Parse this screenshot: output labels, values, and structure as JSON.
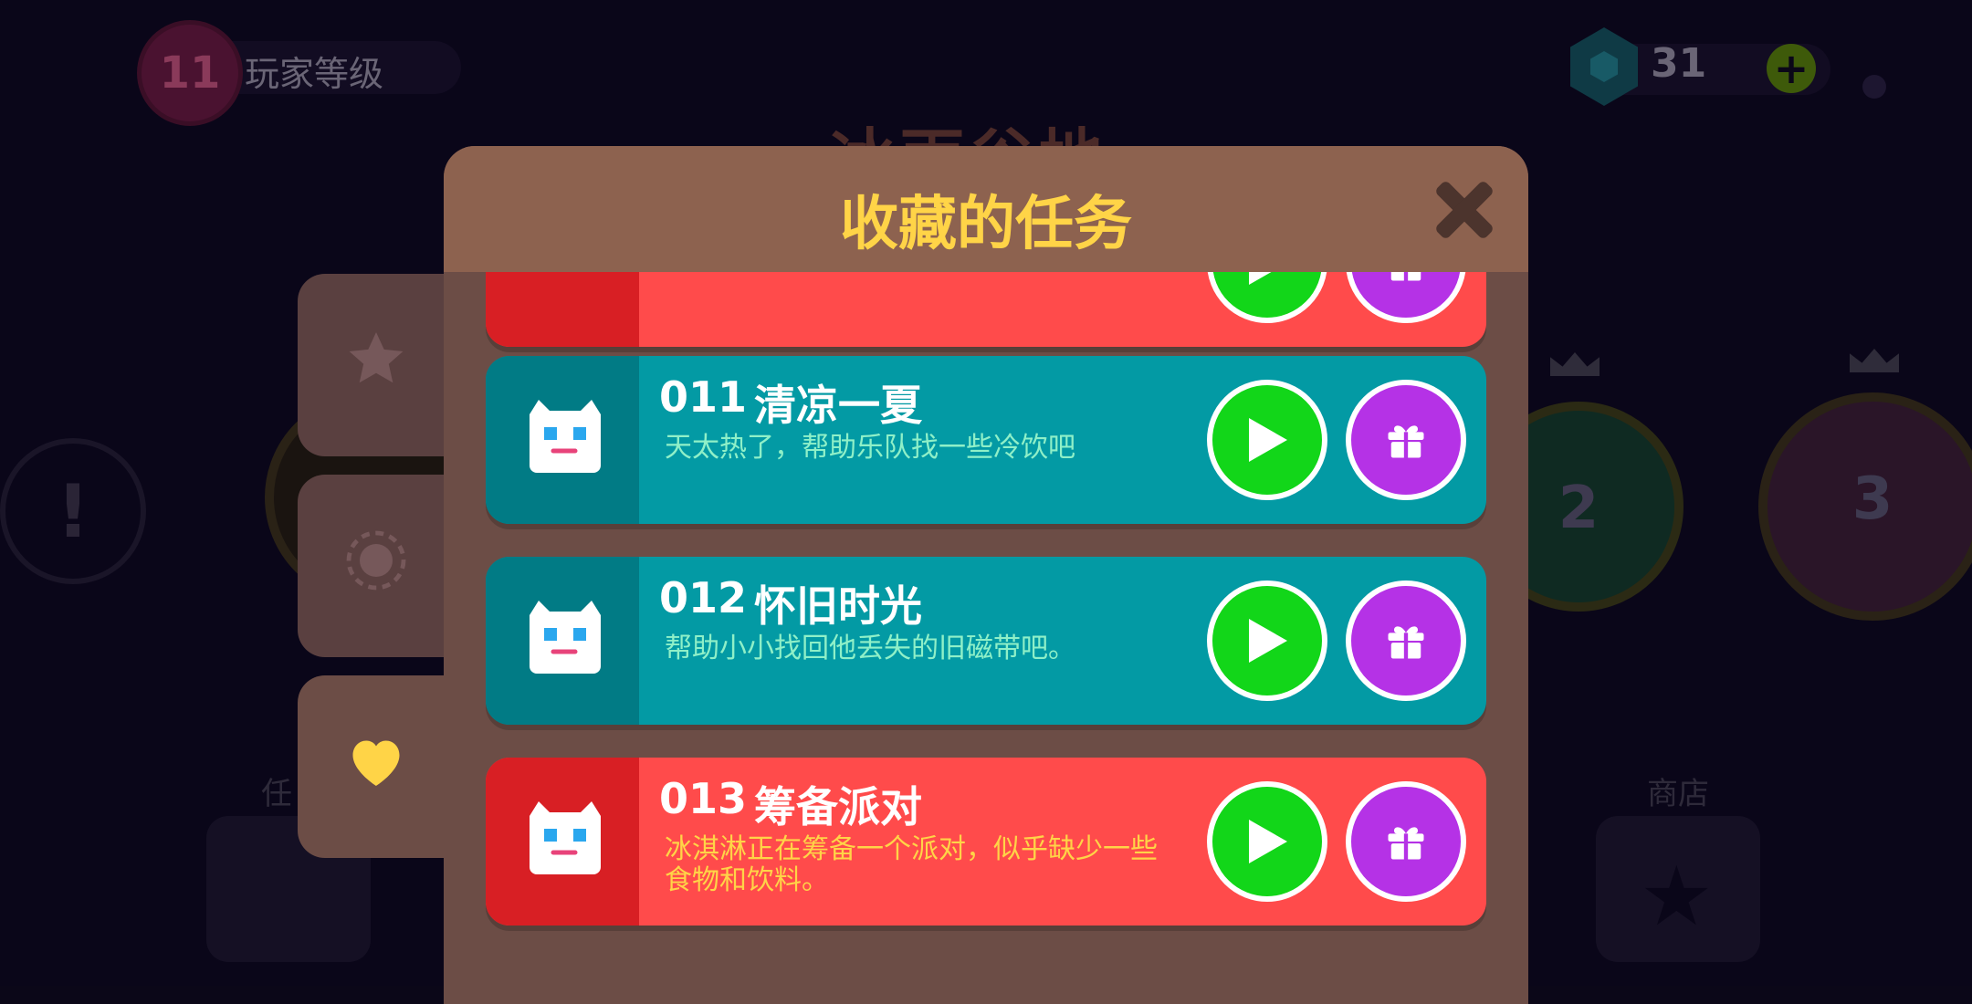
{
  "background": {
    "player_level": "11",
    "player_level_label": "玩家等级",
    "gem_count": "31",
    "area_title": "冰雨谷地",
    "map_node_2": "2",
    "map_node_3": "3",
    "label_left": "任",
    "label_right": "商店"
  },
  "modal": {
    "title": "收藏的任务",
    "tabs": [
      {
        "name": "star-icon",
        "active": false
      },
      {
        "name": "sun-icon",
        "active": false
      },
      {
        "name": "heart-icon",
        "active": true
      }
    ],
    "quests": [
      {
        "code": "",
        "name": "",
        "desc": "",
        "color": "red"
      },
      {
        "code": "011",
        "name": "清凉一夏",
        "desc": "天太热了，帮助乐队找一些冷饮吧",
        "color": "teal"
      },
      {
        "code": "012",
        "name": "怀旧时光",
        "desc": "帮助小小找回他丢失的旧磁带吧。",
        "color": "teal"
      },
      {
        "code": "013",
        "name": "筹备派对",
        "desc": "冰淇淋正在筹备一个派对，似乎缺少一些食物和饮料。",
        "color": "red"
      }
    ]
  },
  "colors": {
    "title_yellow": "#ffd447",
    "teal": "#039aa4",
    "red": "#ff4b4b",
    "play_green": "#12d619",
    "gift_purple": "#b532e6"
  }
}
